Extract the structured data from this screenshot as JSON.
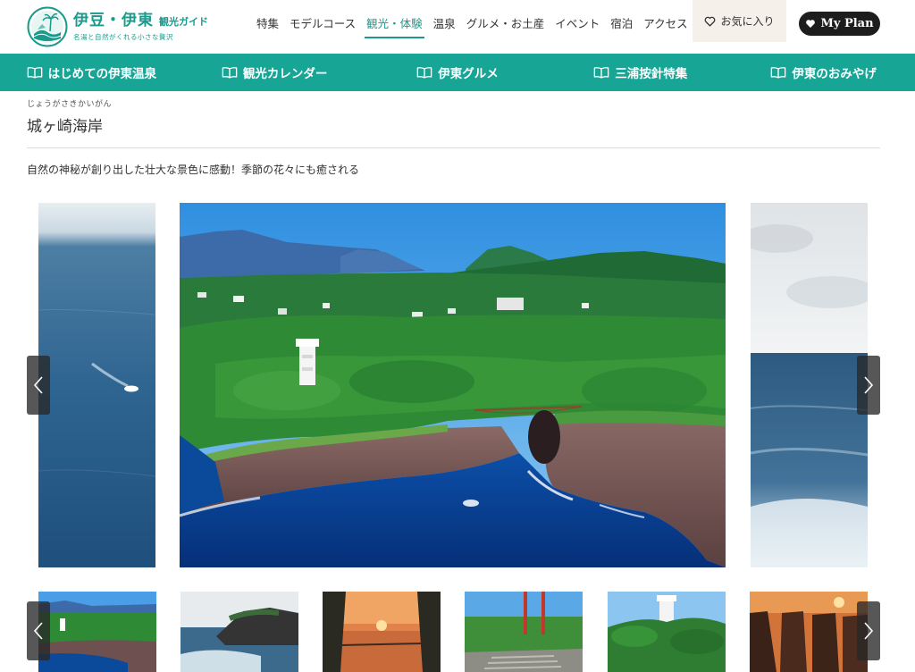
{
  "logo": {
    "title": "伊豆・伊東",
    "subtitle": "観光ガイド",
    "tagline": "名湯と自然がくれる小さな贅沢"
  },
  "topnav": [
    {
      "label": "特集",
      "active": false
    },
    {
      "label": "モデルコース",
      "active": false
    },
    {
      "label": "観光・体験",
      "active": true
    },
    {
      "label": "温泉",
      "active": false
    },
    {
      "label": "グルメ・お土産",
      "active": false
    },
    {
      "label": "イベント",
      "active": false
    },
    {
      "label": "宿泊",
      "active": false
    },
    {
      "label": "アクセス",
      "active": false
    }
  ],
  "favorites_label": "お気に入り",
  "myplan_label": "My Plan",
  "subnav": [
    {
      "label": "はじめての伊東温泉",
      "icon": "book-icon"
    },
    {
      "label": "観光カレンダー",
      "icon": "book-icon"
    },
    {
      "label": "伊東グルメ",
      "icon": "book-icon"
    },
    {
      "label": "三浦按針特集",
      "icon": "book-icon"
    },
    {
      "label": "伊東のおみやげ",
      "icon": "book-icon"
    }
  ],
  "page": {
    "ruby": "じょうがさきかいがん",
    "title": "城ヶ崎海岸",
    "lead": "自然の神秘が創り出した壮大な景色に感動！季節の花々にも癒される"
  },
  "colors": {
    "brand": "#17a596",
    "dark": "#1d1d1d",
    "fav_bg": "#f5f1ea"
  },
  "icons": {
    "favorite": "heart-outline-icon",
    "myplan": "heart-filled-icon",
    "prev": "chevron-left-icon",
    "next": "chevron-right-icon"
  }
}
